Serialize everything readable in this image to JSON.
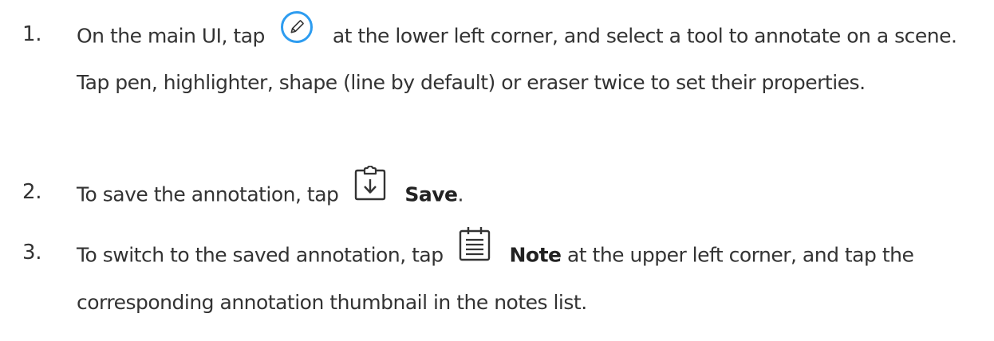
{
  "steps": [
    {
      "number": "1.",
      "text_before_icon": "On the main UI, tap",
      "icon": "pencil-circle-icon",
      "text_after_icon": "at the lower left corner, and select a tool to annotate on a scene. Tap pen, highlighter, shape (line by default) or eraser twice to set their properties."
    },
    {
      "number": "2.",
      "text_before_icon": "To save the annotation, tap",
      "icon": "clipboard-download-icon",
      "bold_label": "Save",
      "text_after_label": "."
    },
    {
      "number": "3.",
      "text_before_icon": "To switch to the saved annotation, tap",
      "icon": "note-list-icon",
      "bold_label": "Note",
      "text_after_label": "at the upper left corner, and tap the corresponding annotation thumbnail in the notes list."
    }
  ],
  "colors": {
    "text": "#333333",
    "accent_blue": "#2d9cf0"
  }
}
